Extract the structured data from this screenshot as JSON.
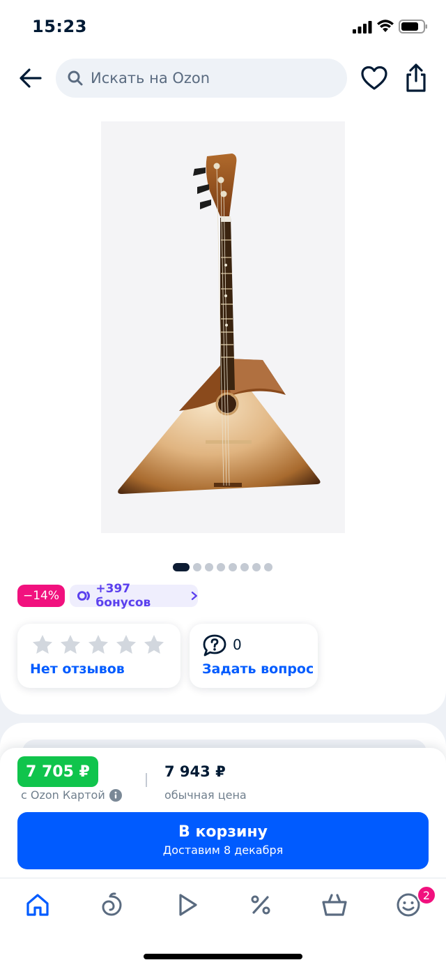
{
  "status_bar": {
    "time": "15:23"
  },
  "header": {
    "search_placeholder": "Искать на Ozon"
  },
  "carousel": {
    "total": 8,
    "active": 0
  },
  "badges": {
    "discount": "−14%",
    "bonus": "+397 бонусов"
  },
  "reviews": {
    "rating_stars": 0,
    "link": "Нет отзывов"
  },
  "questions": {
    "count": "0",
    "link": "Задать вопрос"
  },
  "price": {
    "card_price": "7 705 ₽",
    "card_label": "с Ozon Картой",
    "regular_price": "7 943 ₽",
    "regular_label": "обычная цена"
  },
  "cart_button": {
    "label": "В корзину",
    "delivery": "Доставим 8 декабря"
  },
  "tabbar": {
    "cart_count": "2"
  },
  "colors": {
    "accent": "#005bff",
    "discount": "#f1117e",
    "price_green": "#10c44c",
    "bonus": "#5b40ee"
  }
}
